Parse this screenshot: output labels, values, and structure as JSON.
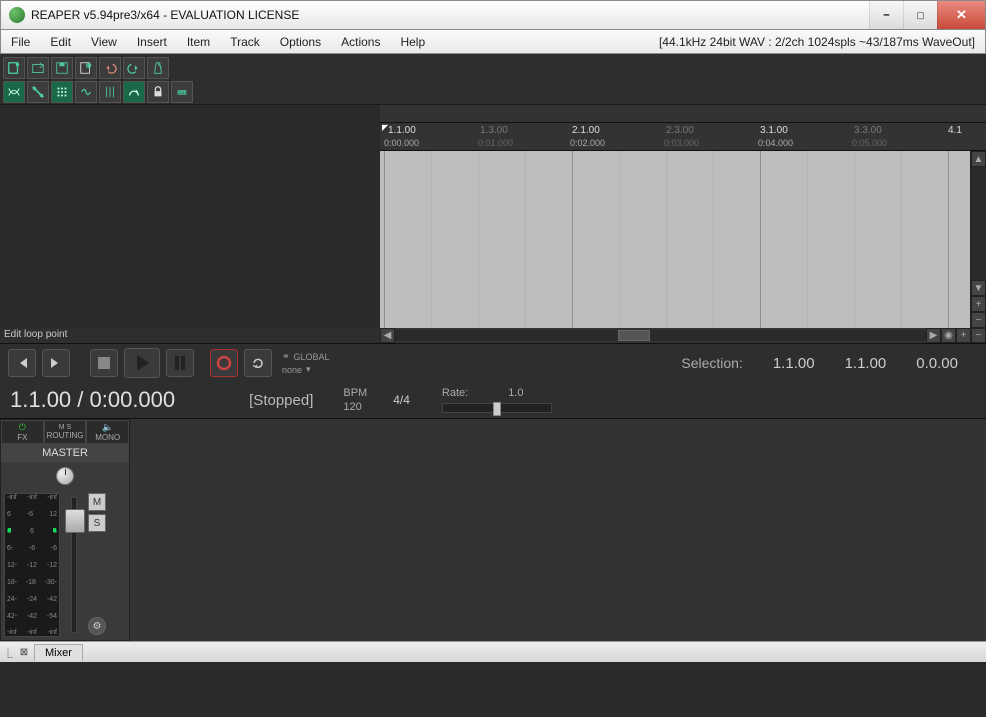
{
  "window": {
    "title": "REAPER v5.94pre3/x64 - EVALUATION LICENSE"
  },
  "menu": {
    "items": [
      "File",
      "Edit",
      "View",
      "Insert",
      "Item",
      "Track",
      "Options",
      "Actions",
      "Help"
    ]
  },
  "audio_status": "[44.1kHz 24bit WAV : 2/2ch 1024spls ~43/187ms WaveOut]",
  "status_hint": "Edit loop point",
  "ruler": {
    "majors": [
      {
        "bar": "1.1.00",
        "time": "0:00.000",
        "pos": 0
      },
      {
        "bar": "2.1.00",
        "time": "0:02.000",
        "pos": 188
      },
      {
        "bar": "3.1.00",
        "time": "0:04.000",
        "pos": 376
      },
      {
        "bar": "4.1",
        "time": "",
        "pos": 564
      }
    ],
    "minors": [
      {
        "bar": "1.3.00",
        "time": "0:01.000",
        "pos": 94
      },
      {
        "bar": "2.3.00",
        "time": "0:03.000",
        "pos": 282
      },
      {
        "bar": "3.3.00",
        "time": "0:05.000",
        "pos": 470
      }
    ]
  },
  "transport": {
    "automation_label": "GLOBAL",
    "automation_mode": "none",
    "selection_label": "Selection:",
    "sel_start": "1.1.00",
    "sel_end": "1.1.00",
    "sel_len": "0.0.00",
    "position": "1.1.00 / 0:00.000",
    "state": "[Stopped]",
    "bpm_label": "BPM",
    "bpm_value": "120",
    "timesig": "4/4",
    "rate_label": "Rate:",
    "rate_value": "1.0"
  },
  "mixer": {
    "power_label": "",
    "fx_label": "FX",
    "ms_label_top": "M    S",
    "routing_label": "ROUTING",
    "mono_label": "MONO",
    "master_label": "MASTER",
    "mute_label": "M",
    "solo_label": "S",
    "scale_ticks": [
      "-inf",
      "6",
      "6",
      "6-",
      "12-",
      "18-",
      "24-",
      "42-",
      "-inf"
    ],
    "scale_ticks_mid": [
      "-inf",
      "-6",
      "6",
      "-6",
      "-12",
      "-18",
      "-24",
      "-42",
      "-inf"
    ],
    "scale_ticks_r": [
      "-inf",
      "12",
      "6",
      "-6",
      "-12",
      "-30-",
      "-42",
      "-54",
      "-inf"
    ]
  },
  "bottom": {
    "tab_label": "Mixer"
  }
}
